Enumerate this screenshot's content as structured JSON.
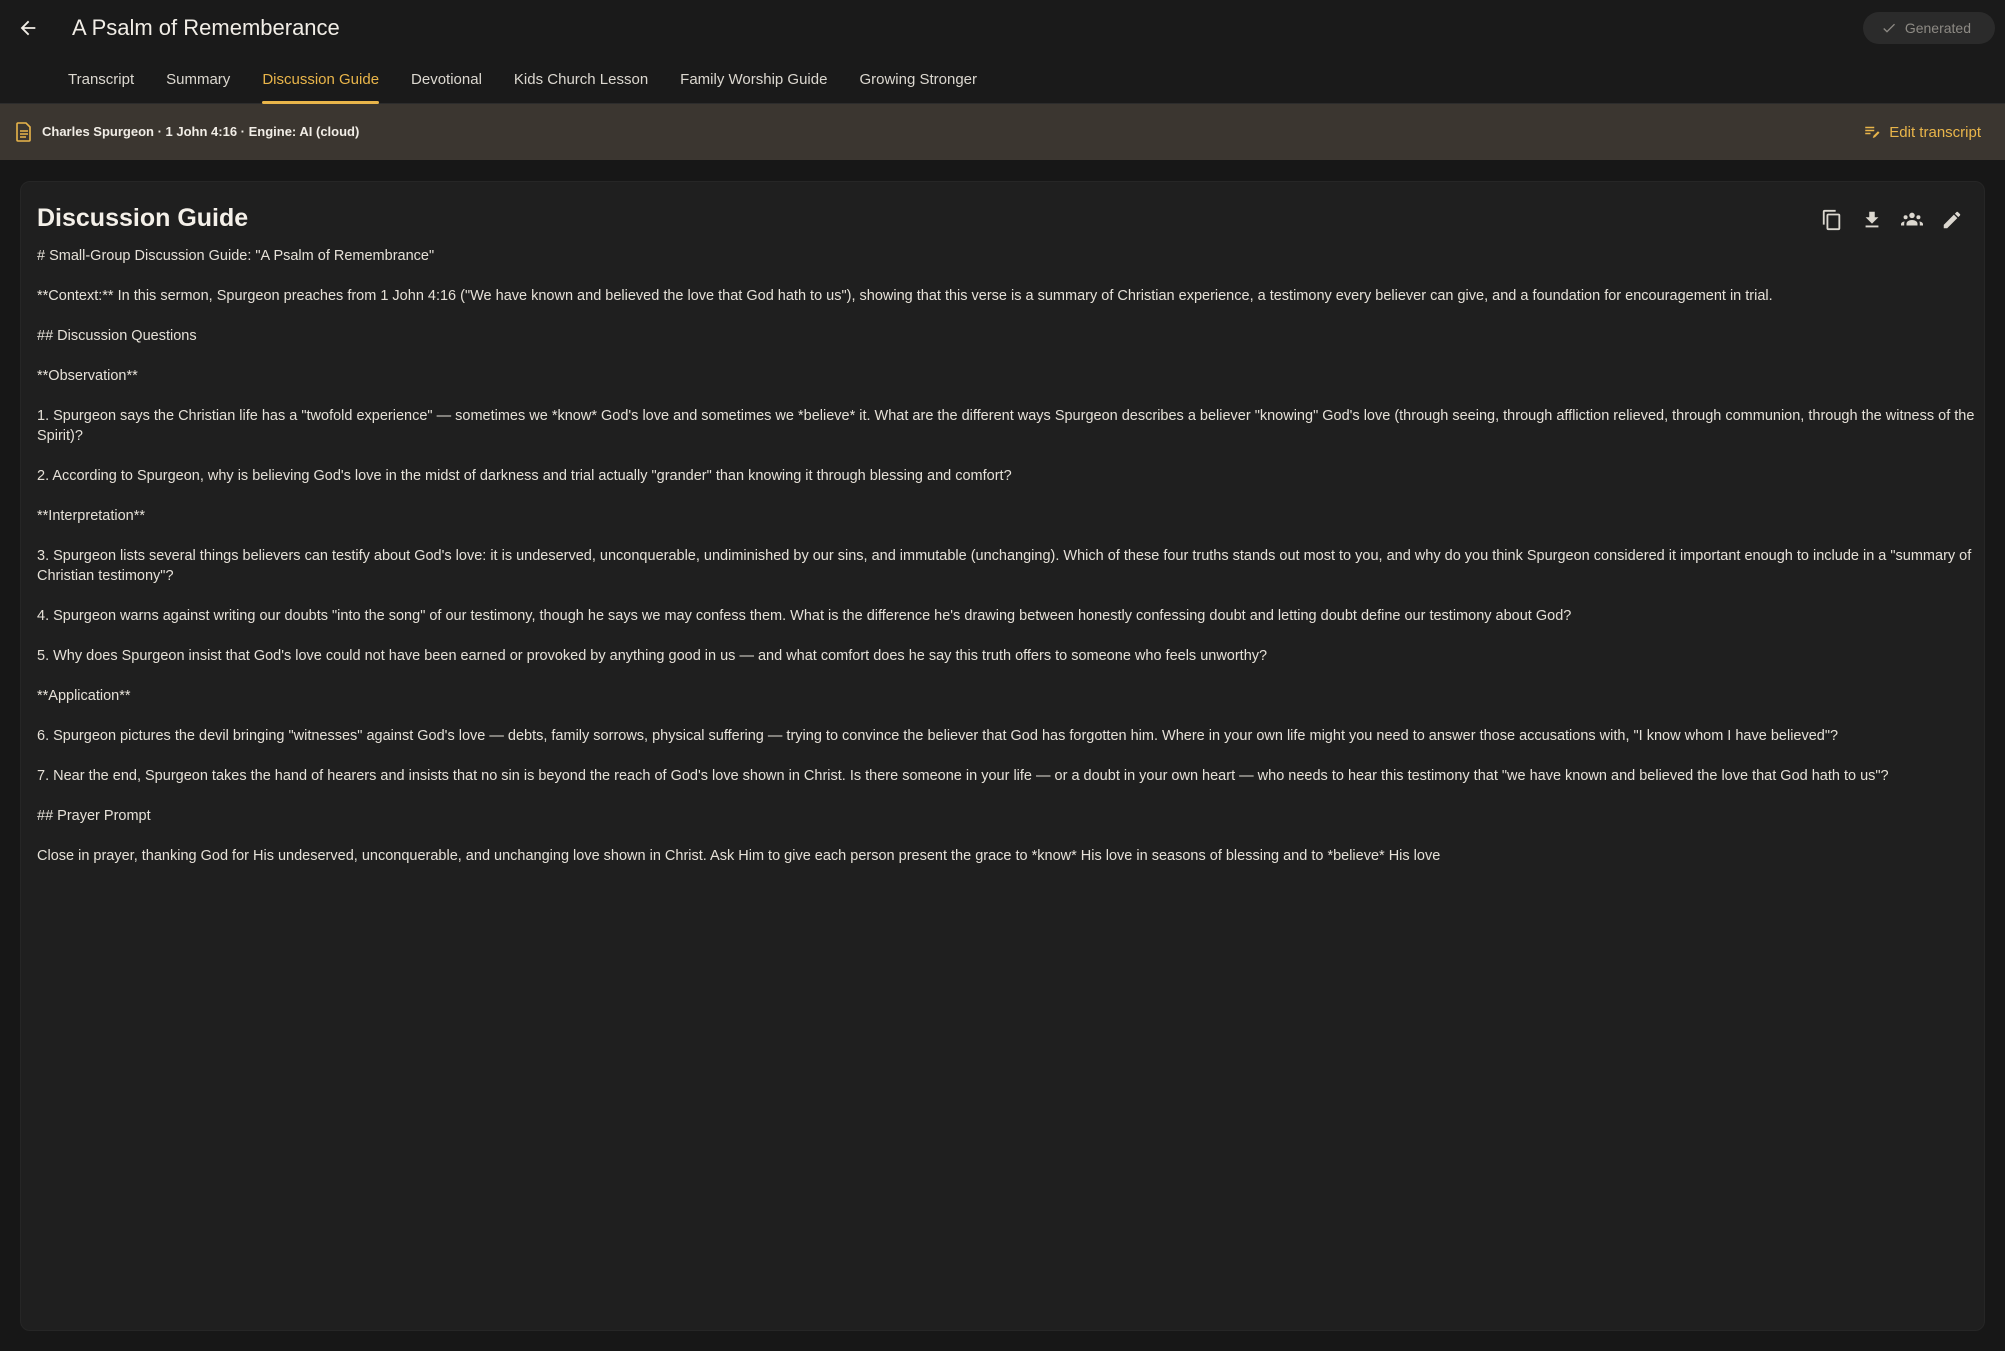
{
  "header": {
    "title": "A Psalm of Rememberance",
    "status": "Generated"
  },
  "tabs": [
    {
      "label": "Transcript",
      "active": false
    },
    {
      "label": "Summary",
      "active": false
    },
    {
      "label": "Discussion Guide",
      "active": true
    },
    {
      "label": "Devotional",
      "active": false
    },
    {
      "label": "Kids Church Lesson",
      "active": false
    },
    {
      "label": "Family Worship Guide",
      "active": false
    },
    {
      "label": "Growing Stronger",
      "active": false
    }
  ],
  "banner": {
    "info": "Charles Spurgeon · 1 John 4:16 · Engine: AI (cloud)",
    "edit_label": "Edit transcript"
  },
  "card": {
    "title": "Discussion Guide",
    "actions": [
      "copy-icon",
      "download-icon",
      "group-icon",
      "edit-icon"
    ],
    "paragraphs": [
      "# Small-Group Discussion Guide: \"A Psalm of Remembrance\"",
      "**Context:** In this sermon, Spurgeon preaches from 1 John 4:16 (\"We have known and believed the love that God hath to us\"), showing that this verse is a summary of Christian experience, a testimony every believer can give, and a foundation for encouragement in trial.",
      "## Discussion Questions",
      "**Observation**",
      "1. Spurgeon says the Christian life has a \"twofold experience\" — sometimes we *know* God's love and sometimes we *believe* it. What are the different ways Spurgeon describes a believer \"knowing\" God's love (through seeing, through affliction relieved, through communion, through the witness of the Spirit)?",
      "2. According to Spurgeon, why is believing God's love in the midst of darkness and trial actually \"grander\" than knowing it through blessing and comfort?",
      "**Interpretation**",
      "3. Spurgeon lists several things believers can testify about God's love: it is undeserved, unconquerable, undiminished by our sins, and immutable (unchanging). Which of these four truths stands out most to you, and why do you think Spurgeon considered it important enough to include in a \"summary of Christian testimony\"?",
      "4. Spurgeon warns against writing our doubts \"into the song\" of our testimony, though he says we may confess them. What is the difference he's drawing between honestly confessing doubt and letting doubt define our testimony about God?",
      "5. Why does Spurgeon insist that God's love could not have been earned or provoked by anything good in us — and what comfort does he say this truth offers to someone who feels unworthy?",
      "**Application**",
      "6. Spurgeon pictures the devil bringing \"witnesses\" against God's love — debts, family sorrows, physical suffering — trying to convince the believer that God has forgotten him. Where in your own life might you need to answer those accusations with, \"I know whom I have believed\"?",
      "7. Near the end, Spurgeon takes the hand of hearers and insists that no sin is beyond the reach of God's love shown in Christ. Is there someone in your life — or a doubt in your own heart — who needs to hear this testimony that \"we have known and believed the love that God hath to us\"?",
      "## Prayer Prompt",
      "Close in prayer, thanking God for His undeserved, unconquerable, and unchanging love shown in Christ. Ask Him to give each person present the grace to *know* His love in seasons of blessing and to *believe* His love"
    ]
  },
  "colors": {
    "accent": "#e9b54a",
    "background": "#171717",
    "banner": "#3b3630",
    "card": "#1f1f1f"
  }
}
